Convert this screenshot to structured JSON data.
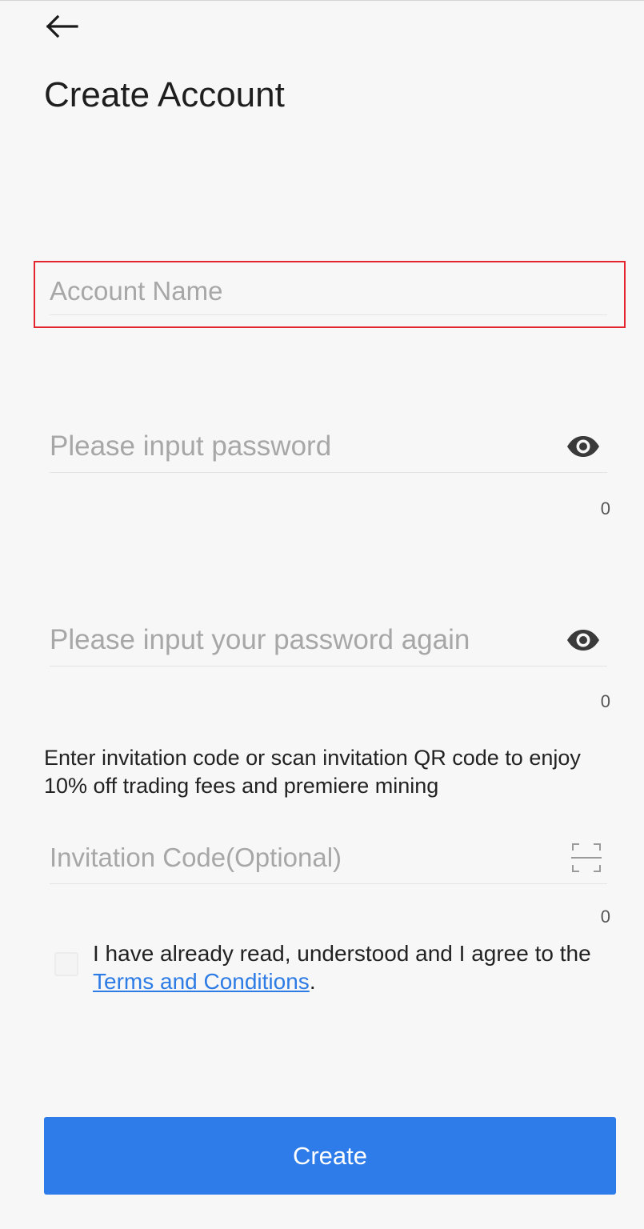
{
  "header": {
    "title": "Create Account",
    "back_icon": "arrow-left-icon"
  },
  "form": {
    "account_name": {
      "value": "",
      "placeholder": "Account Name",
      "highlight_color": "#e3262e"
    },
    "password": {
      "value": "",
      "placeholder": "Please input password",
      "toggle_icon": "eye-icon",
      "char_count": "0"
    },
    "password_confirm": {
      "value": "",
      "placeholder": "Please input your password again",
      "toggle_icon": "eye-icon",
      "char_count": "0"
    },
    "invitation": {
      "promo_text": "Enter invitation code or scan invitation QR code to enjoy 10% off trading fees and premiere mining",
      "value": "",
      "placeholder": "Invitation Code(Optional)",
      "scan_icon": "scan-icon",
      "char_count": "0"
    },
    "agreement": {
      "checked": false,
      "text_before": "I have already read, understood and I agree to the ",
      "link_text": "Terms and Conditions",
      "text_after": "."
    },
    "submit_label": "Create"
  },
  "colors": {
    "primary": "#2e7bea",
    "link": "#2d7be5",
    "background": "#f7f7f7"
  }
}
